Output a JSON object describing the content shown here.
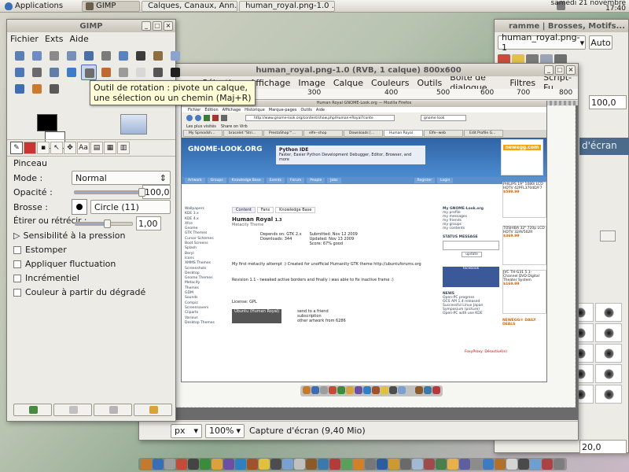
{
  "top_panel": {
    "applications": "Applications",
    "tasks": [
      {
        "label": "GIMP",
        "color": "#6b5e4c",
        "active": true
      },
      {
        "label": "Calques, Canaux, Ann...",
        "color": "#6b5e4c",
        "active": false
      },
      {
        "label": "human_royal.png-1.0 ...",
        "color": "#6b5e4c",
        "active": false
      }
    ],
    "clock_line1": "samedi 21 novembre",
    "clock_line2": "17:40"
  },
  "toolbox": {
    "title": "GIMP",
    "menus": [
      {
        "label": "Fichier"
      },
      {
        "label": "Exts"
      },
      {
        "label": "Aide"
      }
    ],
    "tool_colors": [
      "#5b7fb5",
      "#6c8cc3",
      "#8a8a8a",
      "#7890b8",
      "#4a6fa6",
      "#7b7b7b",
      "#5a82c0",
      "#3c3c3c",
      "#8e6f43",
      "#8aa4cf",
      "#4e78b7",
      "#6a6a6a",
      "#607ea8",
      "#3d7cc9",
      "#6d6d6d",
      "#c06a30",
      "#9b9b9b",
      "#d8d8d8",
      "#555555",
      "#202020",
      "#3e6fb5",
      "#cc7a30",
      "#5a5a5a"
    ],
    "active_tool_index": 14,
    "active_tool_icon": "rotate-tool-icon",
    "tooltip_line1": "Outil de rotation : pivote un calque,",
    "tooltip_line2": "une sélection ou un chemin  (Maj+R)",
    "fg_color": "#000000",
    "bg_color": "#ffffff",
    "options_title": "Pinceau",
    "mode_label": "Mode :",
    "mode_value": "Normal",
    "opacity_label": "Opacité :",
    "opacity_value": "100,0",
    "opacity_fraction": 1.0,
    "brush_label": "Brosse :",
    "brush_value": "Circle (11)",
    "stretch_label": "Étirer ou rétrécir :",
    "stretch_value": "1,00",
    "stretch_fraction": 0.55,
    "pressure_label": "Sensibilité à la pression",
    "checkboxes": [
      {
        "label": "Estomper"
      },
      {
        "label": "Appliquer fluctuation"
      },
      {
        "label": "Incrémentiel"
      },
      {
        "label": "Couleur à partir du dégradé"
      }
    ]
  },
  "image_window": {
    "title": "human_royal.png-1.0 (RVB, 1 calque) 800x600",
    "menus": [
      "Sélection",
      "Affichage",
      "Image",
      "Calque",
      "Couleurs",
      "Outils",
      "Boîte de dialogue",
      "Filtres",
      "Script-Fu"
    ],
    "ruler_marks": [
      "300",
      "400",
      "500",
      "600",
      "700",
      "800"
    ],
    "unit": "px",
    "zoom": "100%",
    "status": "Capture d'écran (9,40 Mio)"
  },
  "firefox": {
    "title": "Human Royal GNOME-Look.org — Mozilla Firefox",
    "menus": [
      "Fichier",
      "Édition",
      "Affichage",
      "Historique",
      "Marque-pages",
      "Outils",
      "Aide"
    ],
    "url": "http://www.gnome-look.org/content/show.php/Human+Royal?conte",
    "search": "gnome look",
    "bookmarks": [
      "Les plus visités",
      "Share on Virb"
    ],
    "tabs": [
      "My Spreadsh...",
      "bracelet \"Stri...",
      "PrestaShop™...",
      "elfe--shop",
      "Downloads [...",
      "Human Royal",
      "Elfe--web",
      "Edit Profile G..."
    ],
    "site_header": "GNOME-LOOK.ORG",
    "python_title": "Python IDE",
    "python_text": "Faster, Easier Python Development Debugger, Editor, Browser, and more",
    "nav_items": [
      "Artwork",
      "Groups",
      "Knowledge Base",
      "Events",
      "Forum",
      "People",
      "Jobs"
    ],
    "right_nav": [
      "Register",
      "Login"
    ],
    "left_items": [
      "Wallpapers",
      "KDE 3.x",
      "KDE 4.x",
      "Xfce",
      "Gnome",
      "GTK Themes",
      "Cursor Schemes",
      "Boot Screens",
      "Splash",
      "Beryl",
      "Icons",
      "XMMS Themes",
      "Screenshots",
      "Desktop",
      "Gnome Themes",
      "Metacity",
      "Themes",
      "GDM",
      "Sounds",
      "Compiz",
      "Screensavers",
      "Cliparts",
      "Various",
      "Desktop Themes"
    ],
    "content_tabs": [
      "Content",
      "Fans",
      "Knowledge Base"
    ],
    "content_title": "Human Royal",
    "content_version": "1.3",
    "content_subtitle": "Metacity Theme",
    "depends": "Depends on: GTK 2.x",
    "downloads": "Downloads: 344",
    "submitted": "Submitted: Nov 12 2009",
    "updated": "Updated: Nov 13 2009",
    "score": "Score: 67% good",
    "description": "My first metacity attempt :) Created for unofficial Humanity GTK theme http://ubuntuforums.org",
    "changelog": "Revision 1.1 - tweaked active borders and finally i was able to fix inactive frame :)",
    "license": "License: GPL",
    "download_btn": "Ubuntu (Human Royal)",
    "send_links": [
      "send to a friend",
      "subscription",
      "other artwork from 6286"
    ],
    "myglo": [
      "My GNOME-Look.org",
      "my profile",
      "my messages",
      "my friends",
      "my groups",
      "my contents"
    ],
    "status_msg": "STATUS MESSAGE",
    "update_btn": "update",
    "news_title": "NEWS",
    "news": [
      "Open-PC progress",
      "OCS API 1.4 released",
      "Successful Linux Japan Symposium (picture)",
      "Open-PC with use KDE"
    ],
    "ads": [
      {
        "name": "PHILIPS 19\" 1080i LCD HDTV 42PFL3704D/F7",
        "price": "$599.99"
      },
      {
        "name": "TOSHIBA 32\" 720p LCD HDTV 32AV502R",
        "price": "$369.99"
      },
      {
        "name": "JVC TH-G31 5.1-Channel DVD Digital Theater System",
        "price": "$169.99"
      }
    ],
    "newegg": "newegg.com",
    "daily_deals": "NEWEGG® DAILY DEALS",
    "foxyproxy": "FoxyProxy: Désactivé(e)"
  },
  "dock_panel": {
    "title": "ramme | Brosses, Motifs...",
    "image_select": "human_royal.png-1",
    "auto_btn": "Auto",
    "opacity_value": "100,0",
    "capture_label": "d'écran",
    "spacing_value": "20,0"
  },
  "dock_icon_colors": [
    "#c47a2e",
    "#3a6db3",
    "#9d9d9d",
    "#c14c3a",
    "#444444",
    "#3b8a3e",
    "#d9a23c",
    "#6b4fa0",
    "#2f7fc1",
    "#a0522d",
    "#e0c040",
    "#4d4d4d",
    "#7aa0d0",
    "#c0c0c0",
    "#8b5a2b",
    "#3c78a8",
    "#b33b3b",
    "#5c9e5c",
    "#d27f2a",
    "#777777",
    "#2d5d9c",
    "#cc9933",
    "#6a6a6a",
    "#a3b8d1",
    "#9e4b4b",
    "#4c7d4c",
    "#e8b04a",
    "#5f5f9f",
    "#8c8c8c",
    "#3e7bbf",
    "#b07030",
    "#d4d4d4",
    "#4a4a4a",
    "#6f9fd0",
    "#a44",
    "#7d7d7d"
  ]
}
